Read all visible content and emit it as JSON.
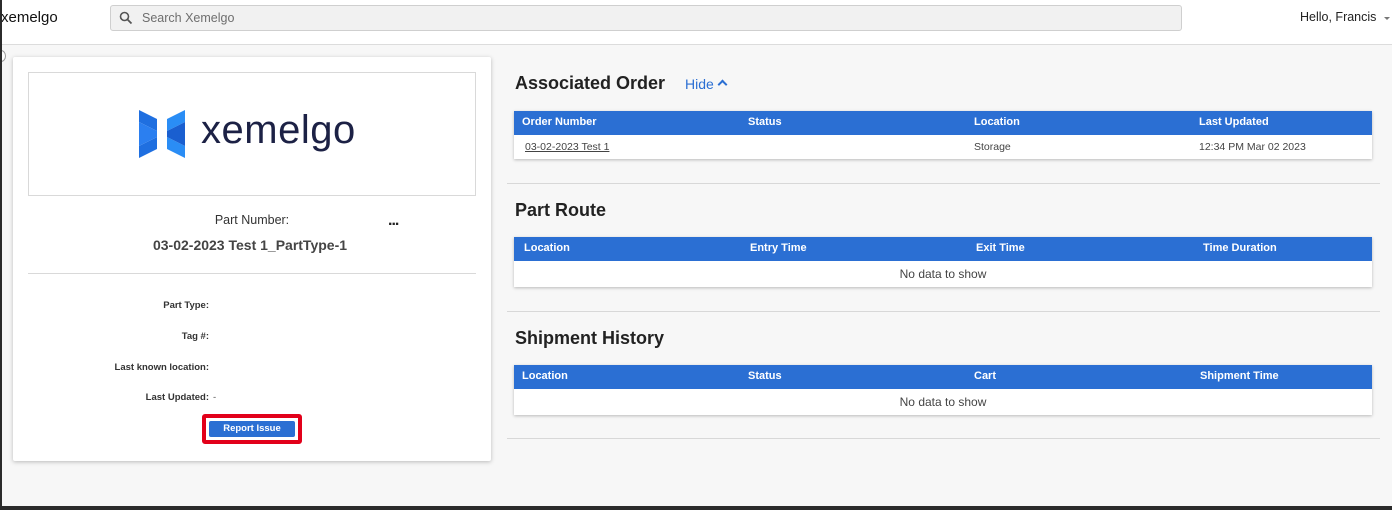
{
  "header": {
    "brand": "xemelgo",
    "search_placeholder": "Search Xemelgo",
    "greeting": "Hello, Francis"
  },
  "part_card": {
    "logo_text": "xemelgo",
    "part_number_label": "Part Number:",
    "part_number_value": "03-02-2023 Test 1_PartType-1",
    "more_label": "...",
    "fields": [
      {
        "label": "Part Type:",
        "value": ""
      },
      {
        "label": "Tag #:",
        "value": ""
      },
      {
        "label": "Last known location:",
        "value": ""
      },
      {
        "label": "Last Updated:",
        "value": "-"
      }
    ],
    "report_button": "Report Issue"
  },
  "associated_order": {
    "title": "Associated Order",
    "hide_label": "Hide",
    "columns": [
      "Order Number",
      "Status",
      "Location",
      "Last Updated"
    ],
    "rows": [
      [
        "03-02-2023 Test 1",
        "",
        "Storage",
        "12:34 PM Mar 02 2023"
      ]
    ]
  },
  "part_route": {
    "title": "Part Route",
    "columns": [
      "Location",
      "Entry Time",
      "Exit Time",
      "Time Duration"
    ],
    "empty_text": "No data to show"
  },
  "shipment_history": {
    "title": "Shipment History",
    "columns": [
      "Location",
      "Status",
      "Cart",
      "Shipment Time"
    ],
    "empty_text": "No data to show"
  },
  "colors": {
    "accent": "#2b6fd3",
    "highlight_outline": "#e2001a",
    "logo_text": "#1c2145"
  }
}
